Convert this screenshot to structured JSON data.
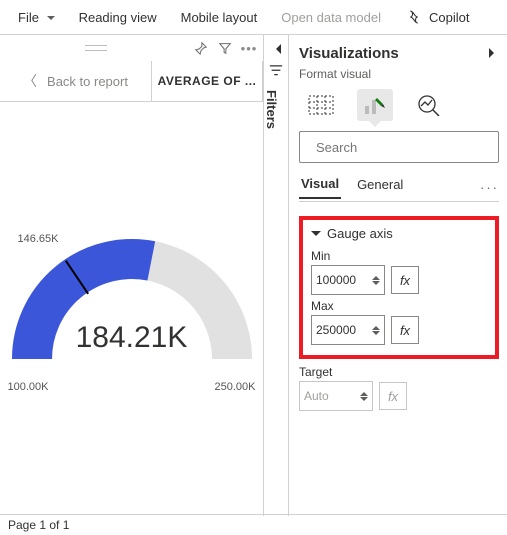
{
  "menubar": {
    "file": "File",
    "reading_view": "Reading view",
    "mobile_layout": "Mobile layout",
    "open_data_model": "Open data model",
    "copilot": "Copilot"
  },
  "visual_header": {
    "back_label": "Back to report",
    "title": "AVERAGE OF ..."
  },
  "filters_pane": {
    "label": "Filters"
  },
  "gauge": {
    "value_label": "184.21K",
    "min_label": "100.00K",
    "max_label": "250.00K",
    "target_label": "146.65K"
  },
  "chart_data": {
    "type": "gauge",
    "title": "AVERAGE OF ...",
    "value": 184210,
    "min": 100000,
    "max": 250000,
    "target": 146650,
    "format": "thousands_K",
    "color": "#3b56d8"
  },
  "viz_panel": {
    "title": "Visualizations",
    "subtitle": "Format visual",
    "search_placeholder": "Search",
    "tabs": {
      "visual": "Visual",
      "general": "General"
    },
    "gauge_axis": {
      "header": "Gauge axis",
      "min_label": "Min",
      "min_value": "100000",
      "max_label": "Max",
      "max_value": "250000",
      "target_label": "Target",
      "target_value": "Auto",
      "fx": "fx"
    }
  },
  "status": {
    "page": "Page 1 of 1"
  }
}
